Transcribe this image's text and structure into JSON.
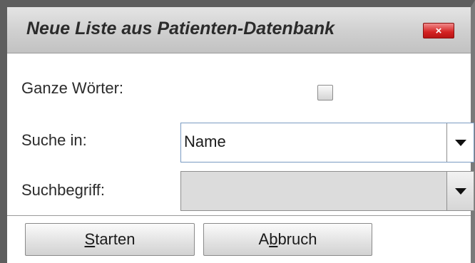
{
  "dialog": {
    "title": "Neue Liste aus Patienten-Datenbank",
    "close_label": "×"
  },
  "fields": {
    "whole_words_label": "Ganze Wörter:",
    "whole_words_checked": false,
    "search_in_label": "Suche in:",
    "search_in_value": "Name",
    "search_term_label": "Suchbegriff:",
    "search_term_value": ""
  },
  "buttons": {
    "start_mnemonic": "S",
    "start_rest": "tarten",
    "cancel_pre": "A",
    "cancel_mnemonic": "b",
    "cancel_rest": "bruch"
  }
}
